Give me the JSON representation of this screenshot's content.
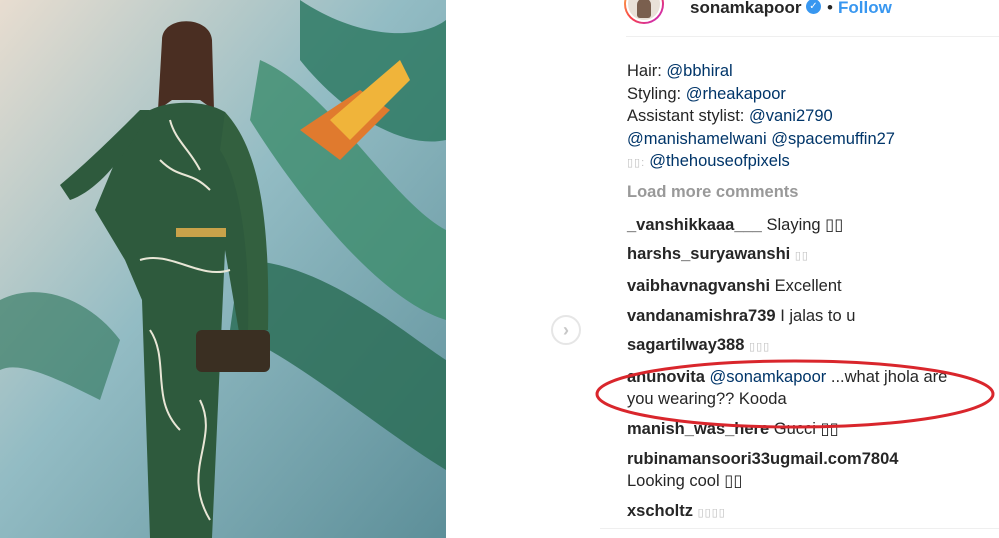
{
  "header": {
    "username": "sonamkapoor",
    "verified_icon": "verified-badge-icon",
    "separator": "•",
    "follow_label": "Follow"
  },
  "caption_lines": [
    {
      "prefix": "Hair: ",
      "mention": "@bbhiral",
      "suffix": ""
    },
    {
      "prefix": "Styling: ",
      "mention": "@rheakapoor",
      "suffix": ""
    },
    {
      "prefix": "Assistant stylist: ",
      "mention": "@vani2790",
      "suffix": ""
    },
    {
      "prefix": "",
      "mention": "@manishamelwani @spacemuffin27",
      "suffix": ""
    },
    {
      "prefix": "▯▯: ",
      "mention": "@thehouseofpixels",
      "suffix": ""
    }
  ],
  "load_more_label": "Load more comments",
  "comments": [
    {
      "user": "_vanshikkaaa___",
      "text": "Slaying ▯▯"
    },
    {
      "user": "harshs_suryawanshi",
      "text": "▯▯"
    },
    {
      "user": "vaibhavnagvanshi",
      "text": "Excellent"
    },
    {
      "user": "vandanamishra739",
      "text": "I jalas to u"
    },
    {
      "user": "sagartilway388",
      "text": "▯▯▯"
    },
    {
      "user": "anunovita",
      "mention": "@sonamkapoor",
      "text": "...what jhola are",
      "text2": "you wearing?? Kooda"
    },
    {
      "user": "manish_was_here",
      "text": "Gucci ▯▯"
    },
    {
      "user": "rubinamansoori33ugmail.com7804",
      "text": "",
      "text2": "Looking cool ▯▯"
    },
    {
      "user": "xscholtz",
      "text": "▯▯▯▯"
    }
  ],
  "icons": {
    "next": "chevron-right-icon"
  },
  "colors": {
    "follow": "#3897f0",
    "mention": "#003569",
    "highlight_oval": "#d9262c"
  }
}
